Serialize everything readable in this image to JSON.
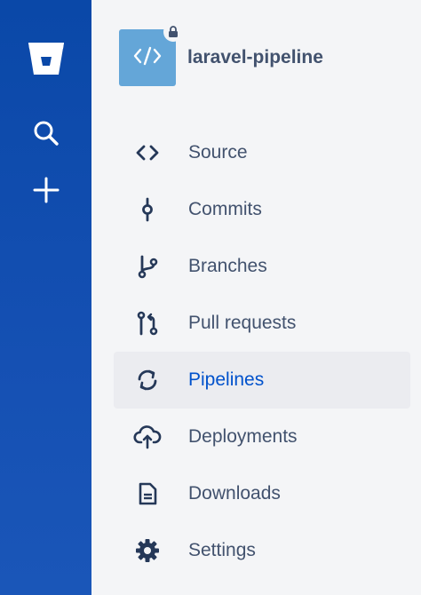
{
  "global_nav": {
    "items": [
      {
        "icon": "bitbucket-logo-icon"
      },
      {
        "icon": "search-icon"
      },
      {
        "icon": "create-icon"
      }
    ]
  },
  "repository": {
    "name": "laravel-pipeline",
    "avatar_icon": "code-icon",
    "private": true
  },
  "nav": {
    "items": [
      {
        "label": "Source",
        "icon": "source-icon"
      },
      {
        "label": "Commits",
        "icon": "commits-icon"
      },
      {
        "label": "Branches",
        "icon": "branches-icon"
      },
      {
        "label": "Pull requests",
        "icon": "pull-requests-icon"
      },
      {
        "label": "Pipelines",
        "icon": "pipelines-icon",
        "selected": true
      },
      {
        "label": "Deployments",
        "icon": "deployments-icon"
      },
      {
        "label": "Downloads",
        "icon": "downloads-icon"
      },
      {
        "label": "Settings",
        "icon": "settings-icon"
      }
    ]
  },
  "colors": {
    "global_nav": "#0a48a8",
    "text": "#42526e",
    "selected_text": "#0052cc",
    "selected_bg": "#ebecf0",
    "avatar": "#64a6d8"
  }
}
